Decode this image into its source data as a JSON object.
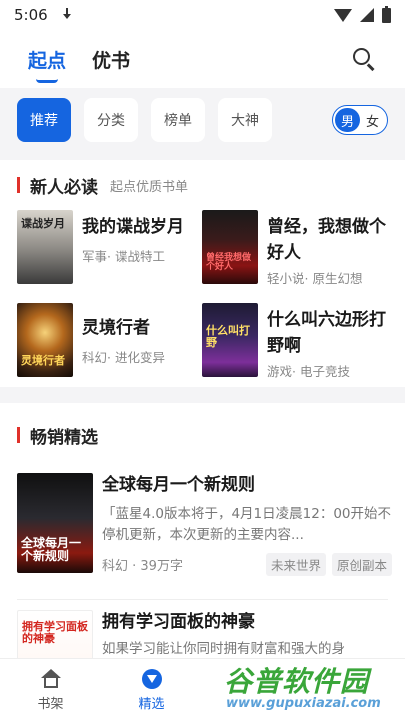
{
  "status_bar": {
    "time": "5:06"
  },
  "top_nav": {
    "tabs": [
      "起点",
      "优书"
    ],
    "active_tab": 0
  },
  "filters": {
    "chips": [
      "推荐",
      "分类",
      "榜单",
      "大神"
    ],
    "active_chip": 0,
    "gender": [
      "男",
      "女"
    ],
    "active_gender": 0
  },
  "new_reader": {
    "title": "新人必读",
    "subtitle": "起点优质书单",
    "books": [
      {
        "title": "我的谍战岁月",
        "meta": "军事· 谍战特工",
        "cover_text": "谍战岁月"
      },
      {
        "title": "曾经，我想做个好人",
        "meta": "轻小说· 原生幻想",
        "cover_text": "曾经我想做个好人"
      },
      {
        "title": "灵境行者",
        "meta": "科幻· 进化变异",
        "cover_text": "灵境行者"
      },
      {
        "title": "什么叫六边形打野啊",
        "meta": "游戏· 电子竞技",
        "cover_text": "什么叫打野"
      }
    ]
  },
  "bestseller": {
    "title": "畅销精选",
    "books": [
      {
        "title": "全球每月一个新规则",
        "desc": "「蓝星4.0版本将于，4月1日凌晨12：00开始不停机更新，本次更新的主要内容...",
        "meta": "科幻 · 39万字",
        "tags": [
          "未来世界",
          "原创副本"
        ],
        "cover_text": "全球每月一个新规则"
      },
      {
        "title": "拥有学习面板的神豪",
        "desc": "如果学习能让你同时拥有财富和强大的身",
        "cover_text": "拥有学习面板的神豪"
      }
    ]
  },
  "bottom_nav": {
    "items": [
      "书架",
      "精选"
    ],
    "active": 1
  },
  "watermark": {
    "main": "谷普软件园",
    "url": "www.gupuxiazai.com"
  },
  "colors": {
    "accent": "#1565e0",
    "section_bar": "#e0312a"
  }
}
